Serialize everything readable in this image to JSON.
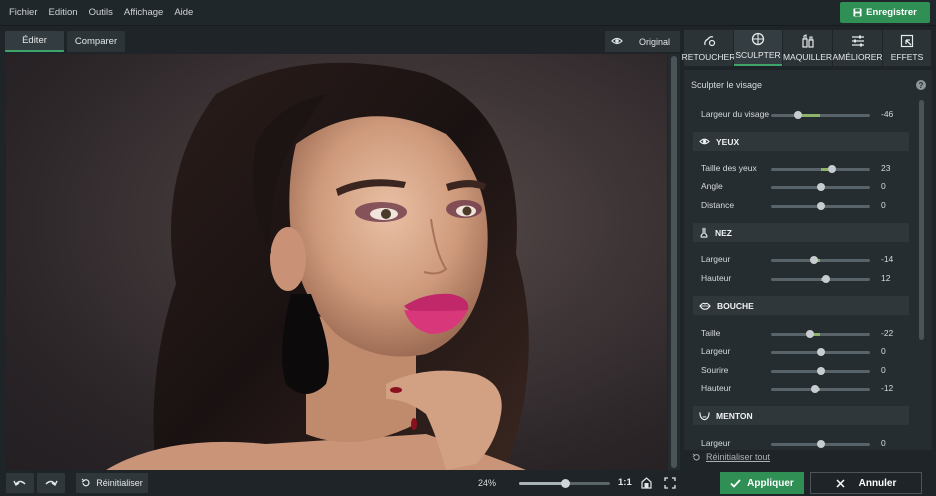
{
  "menu": {
    "items": [
      "Fichier",
      "Edition",
      "Outils",
      "Affichage",
      "Aide"
    ],
    "save_label": "Enregistrer"
  },
  "view_tabs": {
    "edit": "Éditer",
    "compare": "Comparer",
    "original": "Original"
  },
  "right_tabs": [
    {
      "label": "RETOUCHER",
      "icon": "retouch-icon"
    },
    {
      "label": "SCULPTER",
      "icon": "sculpt-icon"
    },
    {
      "label": "MAQUILLER",
      "icon": "makeup-icon"
    },
    {
      "label": "AMÉLIORER",
      "icon": "sliders-icon"
    },
    {
      "label": "EFFETS",
      "icon": "effects-icon"
    }
  ],
  "panel": {
    "title": "Sculpter le visage",
    "face_width": {
      "label": "Largeur du visage",
      "value": -46
    },
    "sections": {
      "eyes": {
        "title": "YEUX",
        "icon": "eye-icon"
      },
      "nose": {
        "title": "NEZ",
        "icon": "nose-icon"
      },
      "mouth": {
        "title": "BOUCHE",
        "icon": "lips-icon"
      },
      "chin": {
        "title": "MENTON",
        "icon": "chin-icon"
      }
    },
    "eyes": {
      "size": {
        "label": "Taille des yeux",
        "value": 23
      },
      "angle": {
        "label": "Angle",
        "value": 0
      },
      "distance": {
        "label": "Distance",
        "value": 0
      }
    },
    "nose": {
      "width": {
        "label": "Largeur",
        "value": -14
      },
      "height": {
        "label": "Hauteur",
        "value": 12
      }
    },
    "mouth": {
      "size": {
        "label": "Taille",
        "value": -22
      },
      "width": {
        "label": "Largeur",
        "value": 0
      },
      "smile": {
        "label": "Sourire",
        "value": 0
      },
      "height": {
        "label": "Hauteur",
        "value": -12
      }
    },
    "chin": {
      "width": {
        "label": "Largeur",
        "value": 0
      }
    },
    "reset_all": "Réinitialiser tout"
  },
  "bottom": {
    "reset_label": "Réinitialiser",
    "zoom": "24%",
    "zoom_fraction": 0.5,
    "one_to_one": "1:1",
    "apply_label": "Appliquer",
    "cancel_label": "Annuler"
  },
  "colors": {
    "accent_green": "#2f8f54",
    "panel_bg": "#262d30",
    "app_bg": "#1e2427"
  }
}
